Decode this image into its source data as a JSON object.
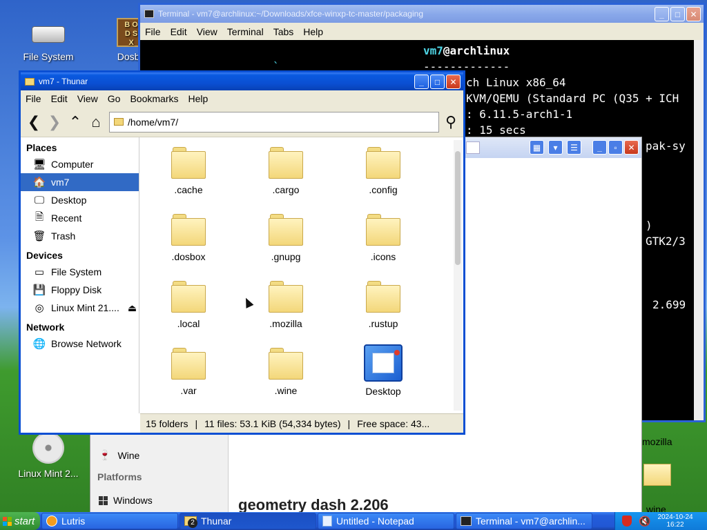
{
  "desktop": {
    "icons": [
      "File System",
      "Dosbo",
      "Linux Mint 2..."
    ]
  },
  "terminal": {
    "title": "Terminal - vm7@archlinux:~/Downloads/xfce-winxp-tc-master/packaging",
    "menu": [
      "File",
      "Edit",
      "View",
      "Terminal",
      "Tabs",
      "Help"
    ],
    "lines": [
      "vm7@archlinux",
      "-------------",
      "ch Linux x86_64",
      "KVM/QEMU (Standard PC (Q35 + ICH",
      ": 6.11.5-arch1-1",
      ": 15 secs",
      "pak-sy",
      ")",
      "GTK2/3",
      "2.699",
      "`"
    ],
    "user": "vm7",
    "at_host": "@archlinux"
  },
  "background_window": {
    "sidebar_items": [
      "Wine",
      "Platforms",
      "Windows"
    ],
    "game_title": "geometry dash 2.206",
    "folder_labels": [
      "mozilla",
      "wine"
    ]
  },
  "thunar": {
    "title": "vm7 - Thunar",
    "menu": [
      "File",
      "Edit",
      "View",
      "Go",
      "Bookmarks",
      "Help"
    ],
    "location": "/home/vm7/",
    "sidebar": {
      "places_header": "Places",
      "places": [
        "Computer",
        "vm7",
        "Desktop",
        "Recent",
        "Trash"
      ],
      "devices_header": "Devices",
      "devices": [
        "File System",
        "Floppy Disk",
        "Linux Mint 21...."
      ],
      "network_header": "Network",
      "network": [
        "Browse Network"
      ]
    },
    "files": [
      ".cache",
      ".cargo",
      ".config",
      ".dosbox",
      ".gnupg",
      ".icons",
      ".local",
      ".mozilla",
      ".rustup",
      ".var",
      ".wine",
      "Desktop"
    ],
    "status": {
      "folders": "15 folders",
      "files": "11 files: 53.1 KiB (54,334 bytes)",
      "free": "Free space: 43..."
    }
  },
  "taskbar": {
    "start": "start",
    "tasks": [
      "Lutris",
      "Thunar",
      "Untitled - Notepad",
      "Terminal - vm7@archlin..."
    ],
    "thunar_count": "2",
    "date": "2024-10-24",
    "time": "16:22"
  },
  "colors": {
    "xp_blue": "#0a4fd3",
    "selection": "#316ac5",
    "terminal_cyan": "#4fd6e6"
  }
}
